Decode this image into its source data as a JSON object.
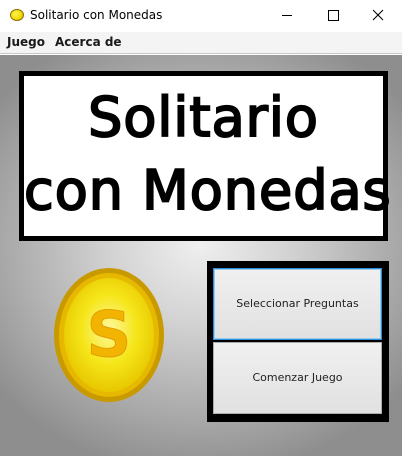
{
  "window": {
    "title": "Solitario con Monedas",
    "icon": "coin-icon"
  },
  "window_controls": {
    "minimize_icon": "minimize-icon",
    "maximize_icon": "maximize-icon",
    "close_icon": "close-icon"
  },
  "menu": {
    "items": [
      {
        "label": "Juego"
      },
      {
        "label": "Acerca de"
      }
    ]
  },
  "main": {
    "title_line1": "Solitario",
    "title_line2": "con Monedas",
    "coin_letter": "S",
    "buttons": [
      {
        "label": "Seleccionar Preguntas"
      },
      {
        "label": "Comenzar Juego"
      }
    ]
  },
  "colors": {
    "coin_fill": "#f5e61a",
    "coin_rim": "#d4a800",
    "coin_letter": "#f0b000",
    "focus_border": "#2a8fdc"
  }
}
